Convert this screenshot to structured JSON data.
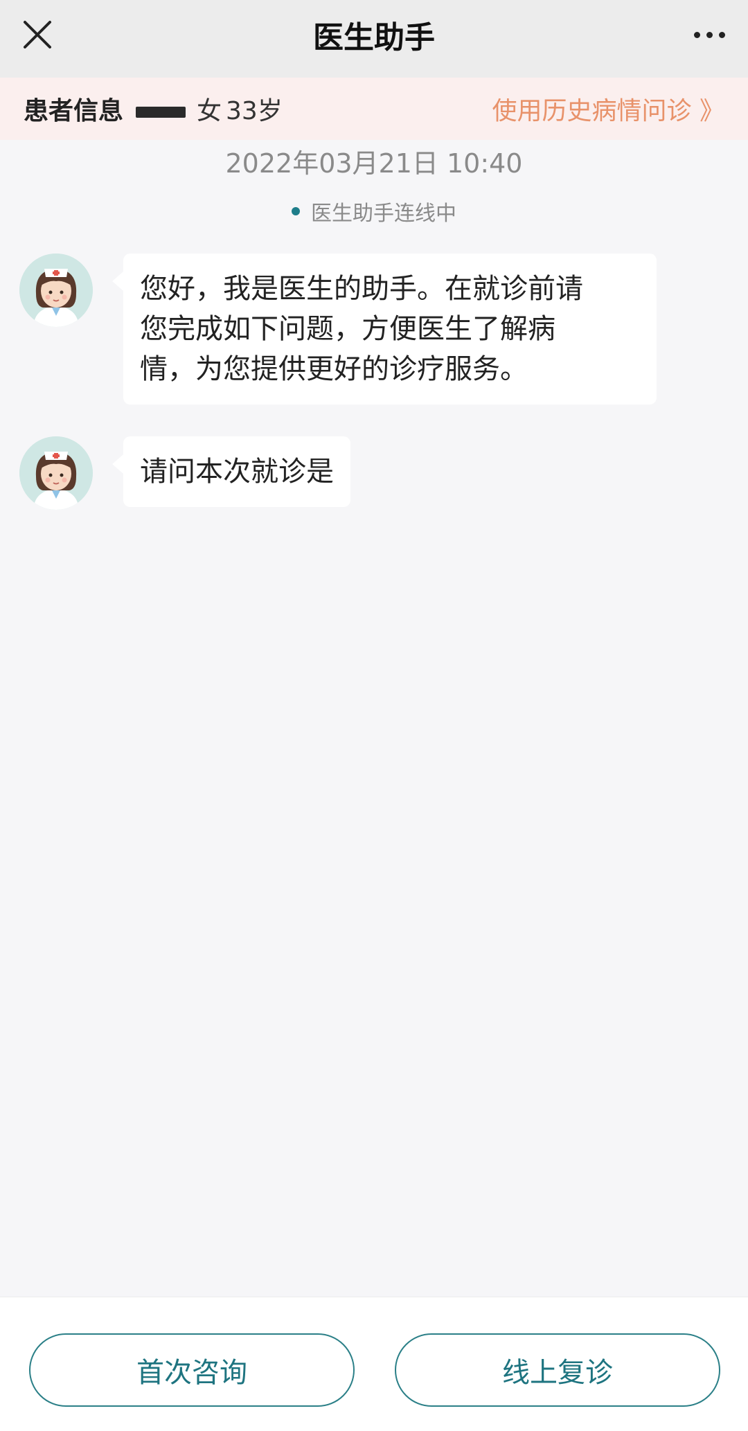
{
  "header": {
    "title": "医生助手",
    "close_icon": "close-icon",
    "more_icon": "more-icon"
  },
  "patient": {
    "label": "患者信息",
    "gender": "女",
    "age": "33岁",
    "history_link": "使用历史病情问诊 》"
  },
  "timestamp": "2022年03月21日 10:40",
  "status": {
    "text": "医生助手连线中",
    "dot_color": "#1e7d8a"
  },
  "messages": [
    {
      "sender": "nurse-avatar",
      "lines": [
        "您好，我是医生的助手。在就诊前请",
        "您完成如下问题，方便医生了解病",
        "情，为您提供更好的诊疗服务。"
      ]
    },
    {
      "sender": "nurse-avatar",
      "lines": [
        "请问本次就诊是"
      ]
    }
  ],
  "actions": {
    "first_consult": "首次咨询",
    "online_followup": "线上复诊"
  },
  "colors": {
    "accent": "#1e7480",
    "link": "#e8926a",
    "patient_bar_bg": "#fbefee"
  }
}
